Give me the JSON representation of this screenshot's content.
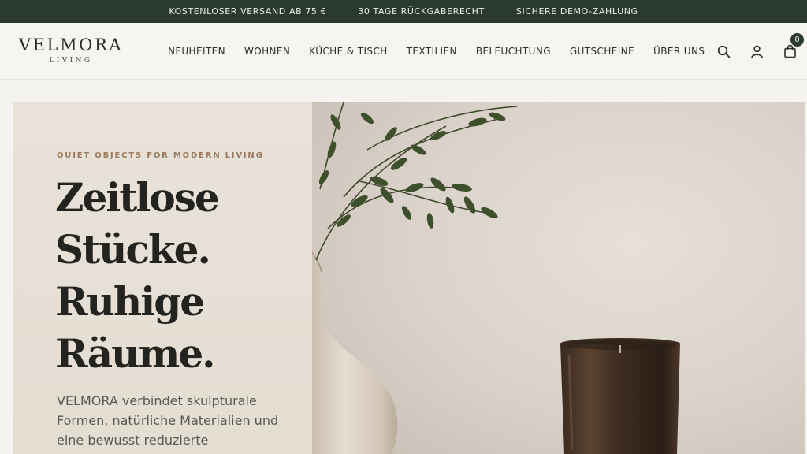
{
  "announcement": {
    "items": [
      "KOSTENLOSER VERSAND AB 75 €",
      "30 TAGE RÜCKGABERECHT",
      "SICHERE DEMO-ZAHLUNG"
    ]
  },
  "header": {
    "brand": "VELMORA",
    "brand_sub": "LIVING",
    "nav": [
      "NEUHEITEN",
      "WOHNEN",
      "KÜCHE & TISCH",
      "TEXTILIEN",
      "BELEUCHTUNG",
      "GUTSCHEINE",
      "ÜBER UNS"
    ],
    "icons": [
      "search-icon",
      "account-icon",
      "bag-icon"
    ],
    "cart_count": "0"
  },
  "hero": {
    "eyebrow": "QUIET OBJECTS FOR MODERN LIVING",
    "headline": [
      "Zeitlose",
      "Stücke.",
      "Ruhige",
      "Räume."
    ],
    "lead": "VELMORA verbindet skulpturale Formen, natürliche Materialien und eine bewusst reduzierte"
  },
  "colors": {
    "topbar": "#2b3a2f",
    "hero_panel": "#e8e2d9",
    "eyebrow": "#9a7a5e"
  }
}
